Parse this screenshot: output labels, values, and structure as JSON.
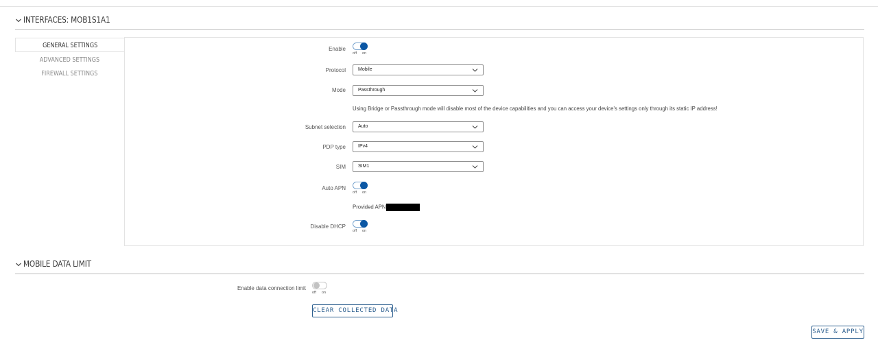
{
  "sections": {
    "interfaces": {
      "title": "INTERFACES: MOB1S1A1"
    },
    "mobile_data_limit": {
      "title": "MOBILE DATA LIMIT"
    }
  },
  "tabs": [
    {
      "label": "GENERAL SETTINGS",
      "active": true
    },
    {
      "label": "ADVANCED SETTINGS",
      "active": false
    },
    {
      "label": "FIREWALL SETTINGS",
      "active": false
    }
  ],
  "toggle_text": {
    "off": "off",
    "on": "on"
  },
  "general": {
    "enable": {
      "label": "Enable",
      "value": "on"
    },
    "protocol": {
      "label": "Protocol",
      "value": "Mobile"
    },
    "mode": {
      "label": "Mode",
      "value": "Passthrough"
    },
    "mode_note": "Using Bridge or Passthrough mode will disable most of the device capabilities and you can access your device's settings only through its static IP address!",
    "subnet_selection": {
      "label": "Subnet selection",
      "value": "Auto"
    },
    "pdp_type": {
      "label": "PDP type",
      "value": "IPv4"
    },
    "sim": {
      "label": "SIM",
      "value": "SIM1"
    },
    "auto_apn": {
      "label": "Auto APN",
      "value": "on"
    },
    "provided_apn": {
      "label": "Provided APN"
    },
    "disable_dhcp": {
      "label": "Disable DHCP",
      "value": "on"
    }
  },
  "mobile_data_limit": {
    "enable_limit": {
      "label": "Enable data connection limit",
      "value": "off"
    },
    "clear_button": "CLEAR COLLECTED DATA"
  },
  "save_button": "SAVE & APPLY",
  "colors": {
    "accent": "#0b57a4",
    "button_border": "#2d5f8f"
  },
  "icons": {
    "section_toggle": "chevron-down-icon",
    "select_arrow": "chevron-down-icon"
  }
}
